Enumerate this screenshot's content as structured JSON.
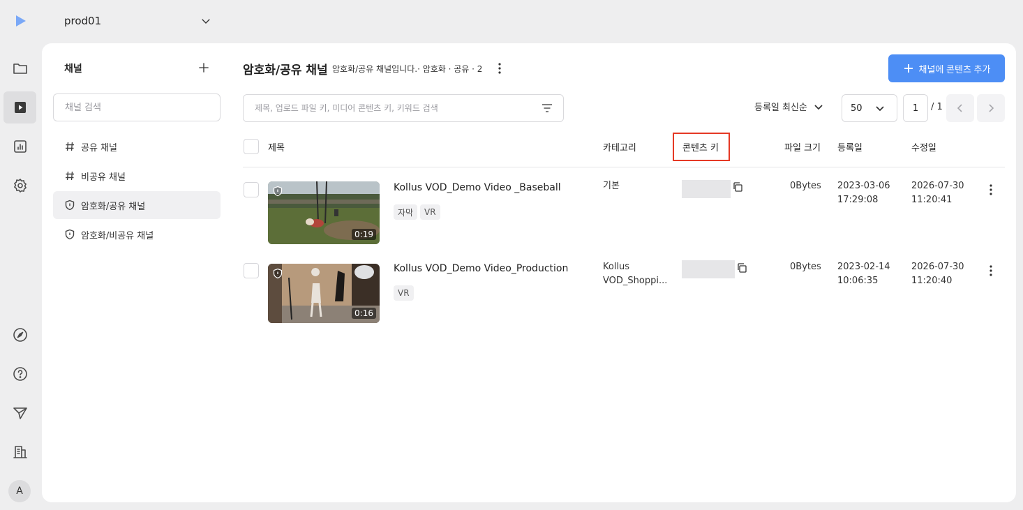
{
  "project": {
    "name": "prod01"
  },
  "rail": {
    "items": [
      "play-logo-icon",
      "folder-icon",
      "video-icon",
      "chart-icon",
      "settings-icon",
      "compass-icon",
      "help-icon",
      "send-icon",
      "building-icon"
    ],
    "avatar": "A"
  },
  "sidebar": {
    "title": "채널",
    "search_placeholder": "채널 검색",
    "channels": [
      {
        "label": "공유 채널",
        "icon": "hash-icon"
      },
      {
        "label": "비공유 채널",
        "icon": "hash-icon"
      },
      {
        "label": "암호화/공유 채널",
        "icon": "shield-icon",
        "active": true
      },
      {
        "label": "암호화/비공유 채널",
        "icon": "shield-icon"
      }
    ]
  },
  "header": {
    "title": "암호화/공유 채널",
    "subtitle": "암호화/공유 채널입니다.· 암호화 · 공유 · 2",
    "add_button": "채널에 콘텐츠 추가"
  },
  "filters": {
    "search_placeholder": "제목, 업로드 파일 키, 미디어 콘텐츠 키, 키워드 검색",
    "sort": "등록일 최신순",
    "page_size": "50",
    "page": "1",
    "page_total": "/ 1"
  },
  "table": {
    "columns": {
      "title": "제목",
      "category": "카테고리",
      "content_key": "콘텐츠 키",
      "file_size": "파일 크기",
      "created": "등록일",
      "modified": "수정일"
    },
    "rows": [
      {
        "title": "Kollus VOD_Demo Video _Baseball",
        "tags": [
          "자막",
          "VR"
        ],
        "duration": "0:19",
        "category_line1": "기본",
        "category_line2": "",
        "file_size": "0Bytes",
        "created_date": "2023-03-06",
        "created_time": "17:29:08",
        "modified_date": "2026-07-30",
        "modified_time": "11:20:41"
      },
      {
        "title": "Kollus VOD_Demo Video_Production",
        "tags": [
          "VR"
        ],
        "duration": "0:16",
        "category_line1": "Kollus",
        "category_line2": "VOD_Shoppi...",
        "file_size": "0Bytes",
        "created_date": "2023-02-14",
        "created_time": "10:06:35",
        "modified_date": "2026-07-30",
        "modified_time": "11:20:40"
      }
    ]
  },
  "colors": {
    "accent": "#4d8ef5",
    "highlight_box": "#e53925"
  }
}
